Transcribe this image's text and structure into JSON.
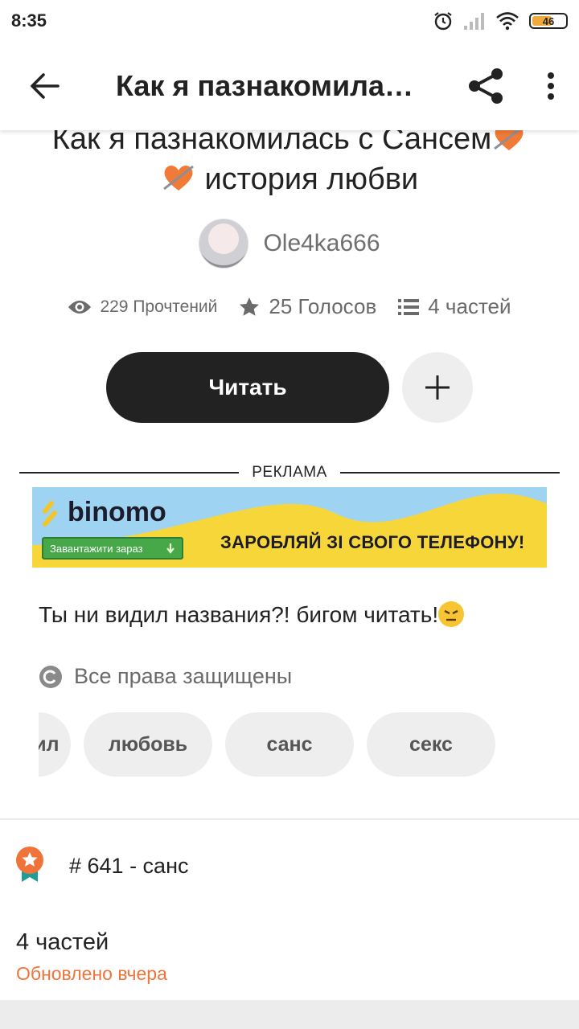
{
  "status_bar": {
    "time": "8:35",
    "battery": "46"
  },
  "toolbar": {
    "title": "Как я пазнакомилась с Сансем"
  },
  "story": {
    "title_line1": "Как я пазнакомилась с Сансем",
    "title_line2": "история любви",
    "author": "Ole4ka666",
    "reads": "229 Прочтений",
    "votes": "25 Голосов",
    "parts": "4 частей",
    "read_button": "Читать",
    "description": "Ты ни видил названия?! бигом читать!",
    "copyright": "Все права защищены",
    "tags": [
      "андертеил",
      "любовь",
      "санс",
      "секс"
    ]
  },
  "ad": {
    "label": "РЕКЛАМА",
    "brand": "binomo",
    "cta": "Завантажити зараз",
    "text": "ЗАРОБЛЯЙ ЗІ СВОГО ТЕЛЕФОНУ!"
  },
  "ranking": {
    "text": "# 641 - санс"
  },
  "parts_section": {
    "title": "4 частей",
    "updated": "Обновлено вчера"
  },
  "colors": {
    "accent": "#f0743a",
    "button_dark": "#222222",
    "chip_bg": "#eeeeee",
    "ad_yellow": "#f7d63a",
    "ad_blue": "#9fd3f2"
  }
}
